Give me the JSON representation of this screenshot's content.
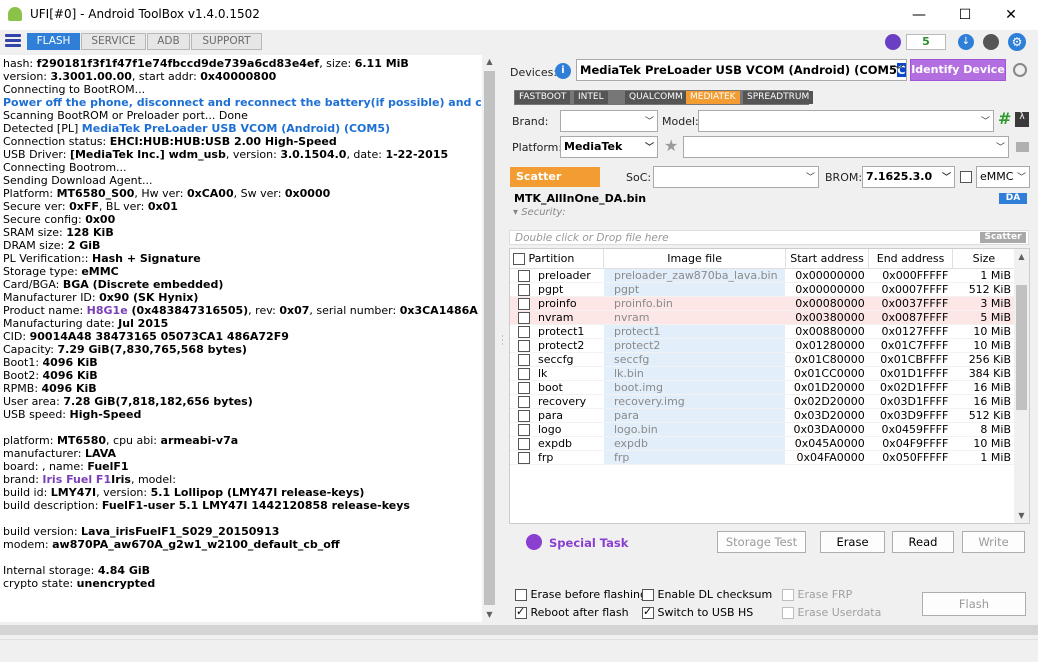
{
  "window": {
    "title": "UFI[#0] - Android ToolBox v1.4.0.1502",
    "minimize": "—",
    "maximize": "☐",
    "close": "✕"
  },
  "tabs": [
    {
      "label": "FLASH",
      "active": true
    },
    {
      "label": "SERVICE",
      "active": false
    },
    {
      "label": "ADB",
      "active": false
    },
    {
      "label": "SUPPORT",
      "active": false
    }
  ],
  "header_counter": "5",
  "log_lines": [
    {
      "t": "  hash: ",
      "b": "f290181f3f1f47f1e74fbccd9de739a6cd83e4ef",
      "t2": ", size: ",
      "b2": "6.11 MiB"
    },
    {
      "t": "  version: ",
      "b": "3.3001.00.00",
      "t2": ", start addr: ",
      "b2": "0x40000800"
    },
    {
      "t": "Connecting to BootROM..."
    },
    {
      "blue": " Power off the phone, disconnect and reconnect the battery(if possible) and connect USB cable."
    },
    {
      "t": " Scanning BootROM or Preloader port... Done"
    },
    {
      "t": " Detected [PL] ",
      "blue": "MediaTek PreLoader USB VCOM (Android) (COM5)"
    },
    {
      "t": " Connection status: ",
      "b": "EHCI:HUB:HUB:USB 2.00 High-Speed"
    },
    {
      "t": " USB Driver: ",
      "b": "[MediaTek Inc.] wdm_usb",
      "t2": ", version: ",
      "b2": "3.0.1504.0",
      "t3": ", date: ",
      "b3": "1-22-2015"
    },
    {
      "t": "Connecting Bootrom..."
    },
    {
      "t": "Sending Download Agent..."
    },
    {
      "t": "Platform: ",
      "b": "MT6580_S00",
      "t2": ", Hw ver: ",
      "b2": "0xCA00",
      "t3": ", Sw ver: ",
      "b3": "0x0000"
    },
    {
      "t": " Secure ver: ",
      "b": "0xFF",
      "t2": ", BL ver: ",
      "b2": "0x01"
    },
    {
      "t": " Secure config: ",
      "b": "0x00"
    },
    {
      "t": " SRAM size: ",
      "b": "128 KiB"
    },
    {
      "t": "DRAM size: ",
      "b": "2 GiB"
    },
    {
      "t": "PL Verification:: ",
      "b": "Hash + Signature"
    },
    {
      "t": "Storage type: ",
      "b": "eMMC"
    },
    {
      "t": "Card/BGA: ",
      "b": "BGA (Discrete embedded)"
    },
    {
      "t": "Manufacturer ID: ",
      "b": "0x90 (SK Hynix)"
    },
    {
      "t": "Product name: ",
      "purple": "H8G1e",
      "b": " (0x483847316505)",
      "t2": ", rev: ",
      "b2": "0x07",
      "t3": ", serial number: ",
      "b3": "0x3CA1486A"
    },
    {
      "t": "Manufacturing date: ",
      "b": "Jul 2015"
    },
    {
      "t": "CID: ",
      "b": "90014A48 38473165 05073CA1 486A72F9"
    },
    {
      "t": "Capacity: ",
      "b": "7.29 GiB(7,830,765,568 bytes)"
    },
    {
      "t": " Boot1: ",
      "b": "4096 KiB"
    },
    {
      "t": " Boot2: ",
      "b": "4096 KiB"
    },
    {
      "t": " RPMB: ",
      "b": "4096 KiB"
    },
    {
      "t": " User area: ",
      "b": "7.28 GiB(7,818,182,656 bytes)"
    },
    {
      "t": "USB speed: ",
      "b": "High-Speed"
    },
    {
      "t": ""
    },
    {
      "t": "platform: ",
      "b": "MT6580",
      "t2": ", cpu abi: ",
      "b2": "armeabi-v7a"
    },
    {
      "t": "manufacturer: ",
      "b": "LAVA"
    },
    {
      "t": "board: , name: ",
      "b": "FuelF1"
    },
    {
      "t": "brand: ",
      "b": "Iris",
      "t2": ", model: ",
      "purple": "Iris Fuel F1"
    },
    {
      "t": "build id: ",
      "b": "LMY47I",
      "t2": ", version: ",
      "b2": "5.1 Lollipop (LMY47I release-keys)"
    },
    {
      "t": "build description: ",
      "b": "FuelF1-user 5.1 LMY47I 1442120858 release-keys"
    },
    {
      "t": ""
    },
    {
      "t": "build version: ",
      "b": "Lava_irisFuelF1_S029_20150913"
    },
    {
      "t": "modem: ",
      "b": "aw870PA_aw670A_g2w1_w2100_default_cb_off"
    },
    {
      "t": ""
    },
    {
      "t": "Internal storage: ",
      "b": "4.84 GiB"
    },
    {
      "t": "crypto state: ",
      "b": "unencrypted"
    }
  ],
  "devices": {
    "label": "Devices:",
    "value": "MediaTek PreLoader USB VCOM (Android) (COM5",
    "highlight": "COM5",
    "identify": "Identify Device"
  },
  "chip_tabs": [
    {
      "label": "FASTBOOT",
      "active": false
    },
    {
      "label": "INTEL",
      "active": false
    },
    {
      "label": "QUALCOMM",
      "active": false
    },
    {
      "label": "MEDIATEK",
      "active": true
    },
    {
      "label": "SPREADTRUM",
      "active": false
    }
  ],
  "brand": {
    "label": "Brand:",
    "value": ""
  },
  "model": {
    "label": "Model:",
    "value": ""
  },
  "platform": {
    "label": "Platform:",
    "value": "MediaTek"
  },
  "scatter": {
    "button": "Scatter",
    "soc_label": "SoC:",
    "soc_value": "",
    "brom_label": "BROM:",
    "brom_value": "7.1625.3.0",
    "storage": "eMMC"
  },
  "da": {
    "file": "MTK_AllInOne_DA.bin",
    "badge": "DA",
    "security": "Security:"
  },
  "drop": {
    "placeholder": "Double click or Drop file here",
    "badge": "Scatter"
  },
  "table": {
    "headers": [
      "Partition",
      "Image file",
      "Start address",
      "End address",
      "Size"
    ],
    "rows": [
      [
        "preloader",
        "preloader_zaw870ba_lava.bin",
        "0x00000000",
        "0x000FFFFF",
        "1 MiB",
        "blue"
      ],
      [
        "pgpt",
        "pgpt",
        "0x00000000",
        "0x0007FFFF",
        "512 KiB",
        "blue"
      ],
      [
        "proinfo",
        "proinfo.bin",
        "0x00080000",
        "0x0037FFFF",
        "3 MiB",
        "pink"
      ],
      [
        "nvram",
        "nvram",
        "0x00380000",
        "0x0087FFFF",
        "5 MiB",
        "pink"
      ],
      [
        "protect1",
        "protect1",
        "0x00880000",
        "0x0127FFFF",
        "10 MiB",
        "blue"
      ],
      [
        "protect2",
        "protect2",
        "0x01280000",
        "0x01C7FFFF",
        "10 MiB",
        "blue"
      ],
      [
        "seccfg",
        "seccfg",
        "0x01C80000",
        "0x01CBFFFF",
        "256 KiB",
        "blue"
      ],
      [
        "lk",
        "lk.bin",
        "0x01CC0000",
        "0x01D1FFFF",
        "384 KiB",
        "blue"
      ],
      [
        "boot",
        "boot.img",
        "0x01D20000",
        "0x02D1FFFF",
        "16 MiB",
        "blue"
      ],
      [
        "recovery",
        "recovery.img",
        "0x02D20000",
        "0x03D1FFFF",
        "16 MiB",
        "blue"
      ],
      [
        "para",
        "para",
        "0x03D20000",
        "0x03D9FFFF",
        "512 KiB",
        "blue"
      ],
      [
        "logo",
        "logo.bin",
        "0x03DA0000",
        "0x0459FFFF",
        "8 MiB",
        "blue"
      ],
      [
        "expdb",
        "expdb",
        "0x045A0000",
        "0x04F9FFFF",
        "10 MiB",
        "blue"
      ],
      [
        "frp",
        "frp",
        "0x04FA0000",
        "0x050FFFFF",
        "1 MiB",
        "blue"
      ]
    ]
  },
  "actions": {
    "special": "Special Task",
    "storage_test": "Storage Test",
    "erase": "Erase",
    "read": "Read",
    "write": "Write"
  },
  "options": {
    "erase_before": "Erase before flashing",
    "enable_dl": "Enable DL checksum",
    "erase_frp": "Erase FRP",
    "reboot_after": "Reboot after flash",
    "switch_usb": "Switch to USB HS",
    "erase_userdata": "Erase Userdata",
    "flash": "Flash"
  },
  "colors": {
    "accent": "#2f7fd8",
    "purple": "#b36ee0",
    "orange": "#f39c32",
    "pink_row": "#fde6e6",
    "blue_cell": "#e2eef9"
  }
}
